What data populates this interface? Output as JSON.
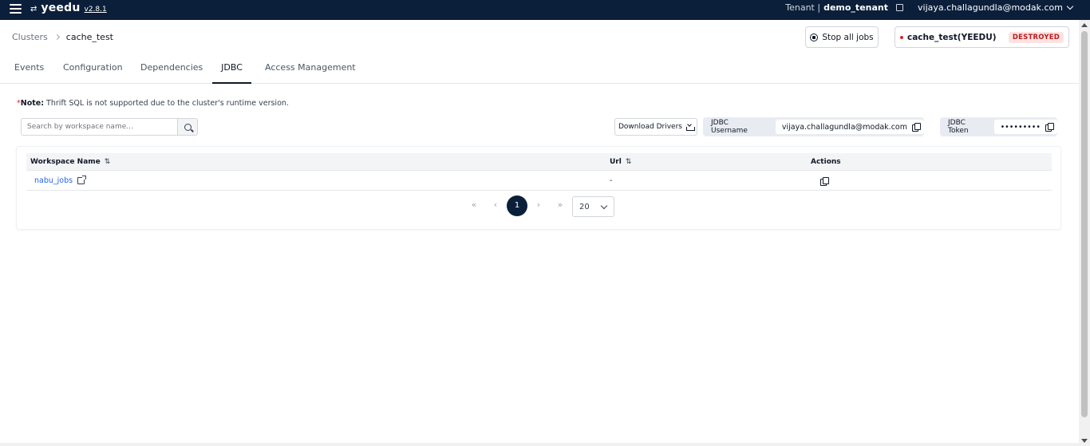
{
  "topbar": {
    "logo_mark": "⌘",
    "app_name": "yeedu",
    "version": "v2.8.1",
    "tenant_label": "Tenant |",
    "tenant_name": "demo_tenant",
    "user_email": "vijaya.challagundla@modak.com"
  },
  "breadcrumb": {
    "parent": "Clusters",
    "current": "cache_test"
  },
  "actions": {
    "stop_all_jobs": "Stop all jobs",
    "cluster_name": "cache_test(YEEDU)",
    "cluster_status": "DESTROYED",
    "status_color": "#b91c1c"
  },
  "tabs": [
    {
      "label": "Events"
    },
    {
      "label": "Configuration"
    },
    {
      "label": "Dependencies"
    },
    {
      "label": "JDBC"
    },
    {
      "label": "Access Management"
    }
  ],
  "active_tab": "JDBC",
  "note": {
    "star": "*",
    "label": "Note:",
    "text": " Thrift SQL is not supported due to the cluster's runtime version."
  },
  "search": {
    "placeholder": "Search by workspace name..."
  },
  "download_drivers": "Download Drivers",
  "jdbc_username": {
    "label": "JDBC Username",
    "value": "vijaya.challagundla@modak.com"
  },
  "jdbc_token": {
    "label": "JDBC Token",
    "value": "•••••••••"
  },
  "table": {
    "columns": [
      {
        "label": "Workspace Name",
        "sortable": true
      },
      {
        "label": "Url",
        "sortable": true
      },
      {
        "label": "Actions",
        "sortable": false
      }
    ],
    "rows": [
      {
        "workspace": "nabu_jobs",
        "url": "-"
      }
    ]
  },
  "pagination": {
    "first": "«",
    "prev": "‹",
    "current_page": "1",
    "next": "›",
    "last": "»",
    "page_size": "20"
  },
  "colors": {
    "topbar": "#0b1f3a",
    "accent": "#0b1f3a",
    "link": "#2563eb"
  }
}
